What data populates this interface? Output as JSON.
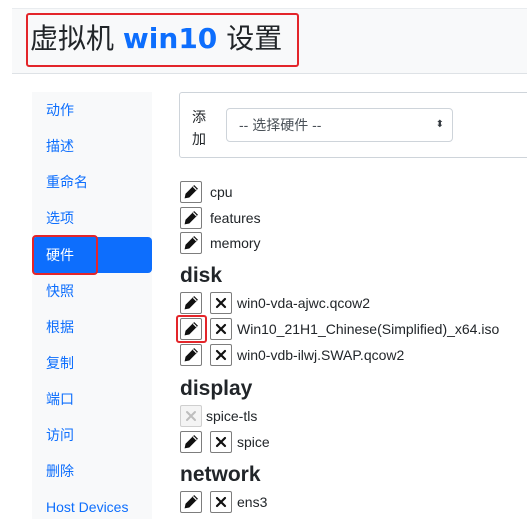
{
  "header": {
    "title_prefix": "虚拟机",
    "vm_name": "win10",
    "title_suffix": "设置"
  },
  "sidebar": {
    "items": [
      {
        "label": "动作"
      },
      {
        "label": "描述"
      },
      {
        "label": "重命名"
      },
      {
        "label": "选项"
      },
      {
        "label": "硬件",
        "active": true
      },
      {
        "label": "快照"
      },
      {
        "label": "根据"
      },
      {
        "label": "复制"
      },
      {
        "label": "端口"
      },
      {
        "label": "访问"
      },
      {
        "label": "删除"
      },
      {
        "label": "Host Devices"
      }
    ]
  },
  "add_hardware": {
    "label": "添加",
    "select_value": "-- 选择硬件 --"
  },
  "hardware": {
    "general": [
      {
        "name": "cpu"
      },
      {
        "name": "features"
      },
      {
        "name": "memory"
      }
    ],
    "disk": {
      "heading": "disk",
      "items": [
        {
          "name": "win0-vda-ajwc.qcow2"
        },
        {
          "name": "Win10_21H1_Chinese(Simplified)_x64.iso"
        },
        {
          "name": "win0-vdb-ilwj.SWAP.qcow2"
        }
      ]
    },
    "display": {
      "heading": "display",
      "items": [
        {
          "name": "spice-tls"
        },
        {
          "name": "spice"
        }
      ]
    },
    "network": {
      "heading": "network",
      "items": [
        {
          "name": "ens3"
        }
      ]
    }
  },
  "colors": {
    "accent": "#0d6efd",
    "highlight_box": "#e3252a",
    "sidebar_bg": "#f8f9fa"
  }
}
